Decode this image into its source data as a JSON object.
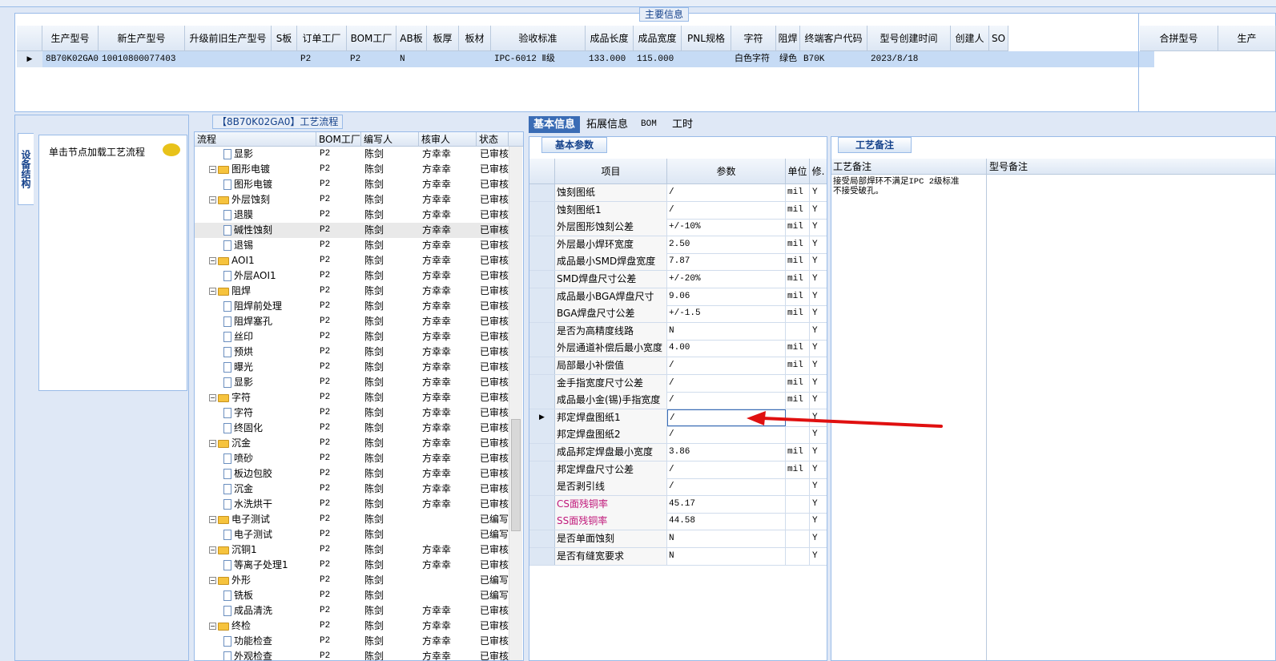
{
  "top": {
    "title": "主要信息",
    "headers": [
      "生产型号",
      "新生产型号",
      "升级前旧生产型号",
      "S板",
      "订单工厂",
      "BOM工厂",
      "AB板",
      "板厚",
      "板材",
      "验收标准",
      "成品长度",
      "成品宽度",
      "PNL规格",
      "字符",
      "阻焊",
      "终端客户代码",
      "型号创建时间",
      "创建人",
      "SO"
    ],
    "row": [
      "8B70K02GA0",
      "10010800077403",
      "",
      "",
      "P2",
      "P2",
      "N",
      "",
      "",
      "IPC-6012 Ⅱ级",
      "133.000",
      "115.000",
      "",
      "白色字符",
      "绿色",
      "B70K",
      "2023/8/18",
      "",
      ""
    ],
    "right_headers": [
      "合拼型号",
      "生产"
    ]
  },
  "left": {
    "vtab": "设备结构",
    "load_text": "单击节点加载工艺流程"
  },
  "tree": {
    "title": "【8B70K02GA0】工艺流程",
    "headers": [
      "流程",
      "BOM工厂",
      "编写人",
      "核审人",
      "状态"
    ],
    "rows": [
      {
        "l": "显影",
        "f": "P2",
        "w": "陈剑",
        "r": "方幸幸",
        "s": "已审核",
        "lv": 2
      },
      {
        "l": "图形电镀",
        "f": "P2",
        "w": "陈剑",
        "r": "方幸幸",
        "s": "已审核",
        "lv": 1
      },
      {
        "l": "图形电镀",
        "f": "P2",
        "w": "陈剑",
        "r": "方幸幸",
        "s": "已审核",
        "lv": 2
      },
      {
        "l": "外层蚀刻",
        "f": "P2",
        "w": "陈剑",
        "r": "方幸幸",
        "s": "已审核",
        "lv": 1
      },
      {
        "l": "退膜",
        "f": "P2",
        "w": "陈剑",
        "r": "方幸幸",
        "s": "已审核",
        "lv": 2
      },
      {
        "l": "碱性蚀刻",
        "f": "P2",
        "w": "陈剑",
        "r": "方幸幸",
        "s": "已审核",
        "lv": 2
      },
      {
        "l": "退锡",
        "f": "P2",
        "w": "陈剑",
        "r": "方幸幸",
        "s": "已审核",
        "lv": 2
      },
      {
        "l": "AOI1",
        "f": "P2",
        "w": "陈剑",
        "r": "方幸幸",
        "s": "已审核",
        "lv": 1
      },
      {
        "l": "外层AOI1",
        "f": "P2",
        "w": "陈剑",
        "r": "方幸幸",
        "s": "已审核",
        "lv": 2
      },
      {
        "l": "阻焊",
        "f": "P2",
        "w": "陈剑",
        "r": "方幸幸",
        "s": "已审核",
        "lv": 1
      },
      {
        "l": "阻焊前处理",
        "f": "P2",
        "w": "陈剑",
        "r": "方幸幸",
        "s": "已审核",
        "lv": 2
      },
      {
        "l": "阻焊塞孔",
        "f": "P2",
        "w": "陈剑",
        "r": "方幸幸",
        "s": "已审核",
        "lv": 2
      },
      {
        "l": "丝印",
        "f": "P2",
        "w": "陈剑",
        "r": "方幸幸",
        "s": "已审核",
        "lv": 2
      },
      {
        "l": "预烘",
        "f": "P2",
        "w": "陈剑",
        "r": "方幸幸",
        "s": "已审核",
        "lv": 2
      },
      {
        "l": "曝光",
        "f": "P2",
        "w": "陈剑",
        "r": "方幸幸",
        "s": "已审核",
        "lv": 2
      },
      {
        "l": "显影",
        "f": "P2",
        "w": "陈剑",
        "r": "方幸幸",
        "s": "已审核",
        "lv": 2
      },
      {
        "l": "字符",
        "f": "P2",
        "w": "陈剑",
        "r": "方幸幸",
        "s": "已审核",
        "lv": 1
      },
      {
        "l": "字符",
        "f": "P2",
        "w": "陈剑",
        "r": "方幸幸",
        "s": "已审核",
        "lv": 2
      },
      {
        "l": "终固化",
        "f": "P2",
        "w": "陈剑",
        "r": "方幸幸",
        "s": "已审核",
        "lv": 2
      },
      {
        "l": "沉金",
        "f": "P2",
        "w": "陈剑",
        "r": "方幸幸",
        "s": "已审核",
        "lv": 1
      },
      {
        "l": "喷砂",
        "f": "P2",
        "w": "陈剑",
        "r": "方幸幸",
        "s": "已审核",
        "lv": 2
      },
      {
        "l": "板边包胶",
        "f": "P2",
        "w": "陈剑",
        "r": "方幸幸",
        "s": "已审核",
        "lv": 2
      },
      {
        "l": "沉金",
        "f": "P2",
        "w": "陈剑",
        "r": "方幸幸",
        "s": "已审核",
        "lv": 2
      },
      {
        "l": "水洗烘干",
        "f": "P2",
        "w": "陈剑",
        "r": "方幸幸",
        "s": "已审核",
        "lv": 2
      },
      {
        "l": "电子测试",
        "f": "P2",
        "w": "陈剑",
        "r": "",
        "s": "已编写",
        "lv": 1
      },
      {
        "l": "电子测试",
        "f": "P2",
        "w": "陈剑",
        "r": "",
        "s": "已编写",
        "lv": 2
      },
      {
        "l": "沉铜1",
        "f": "P2",
        "w": "陈剑",
        "r": "方幸幸",
        "s": "已审核",
        "lv": 1
      },
      {
        "l": "等离子处理1",
        "f": "P2",
        "w": "陈剑",
        "r": "方幸幸",
        "s": "已审核",
        "lv": 2
      },
      {
        "l": "外形",
        "f": "P2",
        "w": "陈剑",
        "r": "",
        "s": "已编写",
        "lv": 1
      },
      {
        "l": "铣板",
        "f": "P2",
        "w": "陈剑",
        "r": "",
        "s": "已编写",
        "lv": 2
      },
      {
        "l": "成品清洗",
        "f": "P2",
        "w": "陈剑",
        "r": "方幸幸",
        "s": "已审核",
        "lv": 2
      },
      {
        "l": "终检",
        "f": "P2",
        "w": "陈剑",
        "r": "方幸幸",
        "s": "已审核",
        "lv": 1
      },
      {
        "l": "功能检查",
        "f": "P2",
        "w": "陈剑",
        "r": "方幸幸",
        "s": "已审核",
        "lv": 2
      },
      {
        "l": "外观检查",
        "f": "P2",
        "w": "陈剑",
        "r": "方幸幸",
        "s": "已审核",
        "lv": 2
      }
    ]
  },
  "tabs": [
    "基本信息",
    "拓展信息",
    "BOM",
    "工时"
  ],
  "basic": {
    "tab": "基本参数",
    "headers": [
      "项目",
      "参数",
      "单位",
      "修."
    ],
    "rows": [
      {
        "n": "蚀刻图纸",
        "v": "/",
        "u": "mil",
        "m": "Y"
      },
      {
        "n": "蚀刻图纸1",
        "v": "/",
        "u": "mil",
        "m": "Y"
      },
      {
        "n": "外层图形蚀刻公差",
        "v": "+/-10%",
        "u": "mil",
        "m": "Y"
      },
      {
        "n": "外层最小焊环宽度",
        "v": "2.50",
        "u": "mil",
        "m": "Y"
      },
      {
        "n": "成品最小SMD焊盘宽度",
        "v": "7.87",
        "u": "mil",
        "m": "Y"
      },
      {
        "n": "SMD焊盘尺寸公差",
        "v": "+/-20%",
        "u": "mil",
        "m": "Y"
      },
      {
        "n": "成品最小BGA焊盘尺寸",
        "v": "9.06",
        "u": "mil",
        "m": "Y"
      },
      {
        "n": "BGA焊盘尺寸公差",
        "v": "+/-1.5",
        "u": "mil",
        "m": "Y"
      },
      {
        "n": "是否为高精度线路",
        "v": "N",
        "u": "",
        "m": "Y"
      },
      {
        "n": "外层通道补偿后最小宽度",
        "v": "4.00",
        "u": "mil",
        "m": "Y"
      },
      {
        "n": "局部最小补偿值",
        "v": "/",
        "u": "mil",
        "m": "Y"
      },
      {
        "n": "金手指宽度尺寸公差",
        "v": "/",
        "u": "mil",
        "m": "Y"
      },
      {
        "n": "成品最小金(锡)手指宽度",
        "v": "/",
        "u": "mil",
        "m": "Y"
      },
      {
        "n": "邦定焊盘图纸1",
        "v": "/",
        "u": "",
        "m": "Y"
      },
      {
        "n": "邦定焊盘图纸2",
        "v": "/",
        "u": "",
        "m": "Y"
      },
      {
        "n": "成品邦定焊盘最小宽度",
        "v": "3.86",
        "u": "mil",
        "m": "Y"
      },
      {
        "n": "邦定焊盘尺寸公差",
        "v": "/",
        "u": "mil",
        "m": "Y"
      },
      {
        "n": "是否剥引线",
        "v": "/",
        "u": "",
        "m": "Y"
      },
      {
        "n": "CS面残铜率",
        "v": "45.17",
        "u": "",
        "m": "Y"
      },
      {
        "n": "SS面残铜率",
        "v": "44.58",
        "u": "",
        "m": "Y"
      },
      {
        "n": "是否单面蚀刻",
        "v": "N",
        "u": "",
        "m": "Y"
      },
      {
        "n": "是否有缝宽要求",
        "v": "N",
        "u": "",
        "m": "Y"
      }
    ]
  },
  "notes": {
    "tab": "工艺备注",
    "col1": "工艺备注",
    "col2": "型号备注",
    "text": "接受局部焊环不满足IPC 2级标准\n不接受破孔。"
  },
  "colors": {
    "accent": "#3a6cb5",
    "arrow": "#e01010",
    "pink": "#c0187a"
  }
}
